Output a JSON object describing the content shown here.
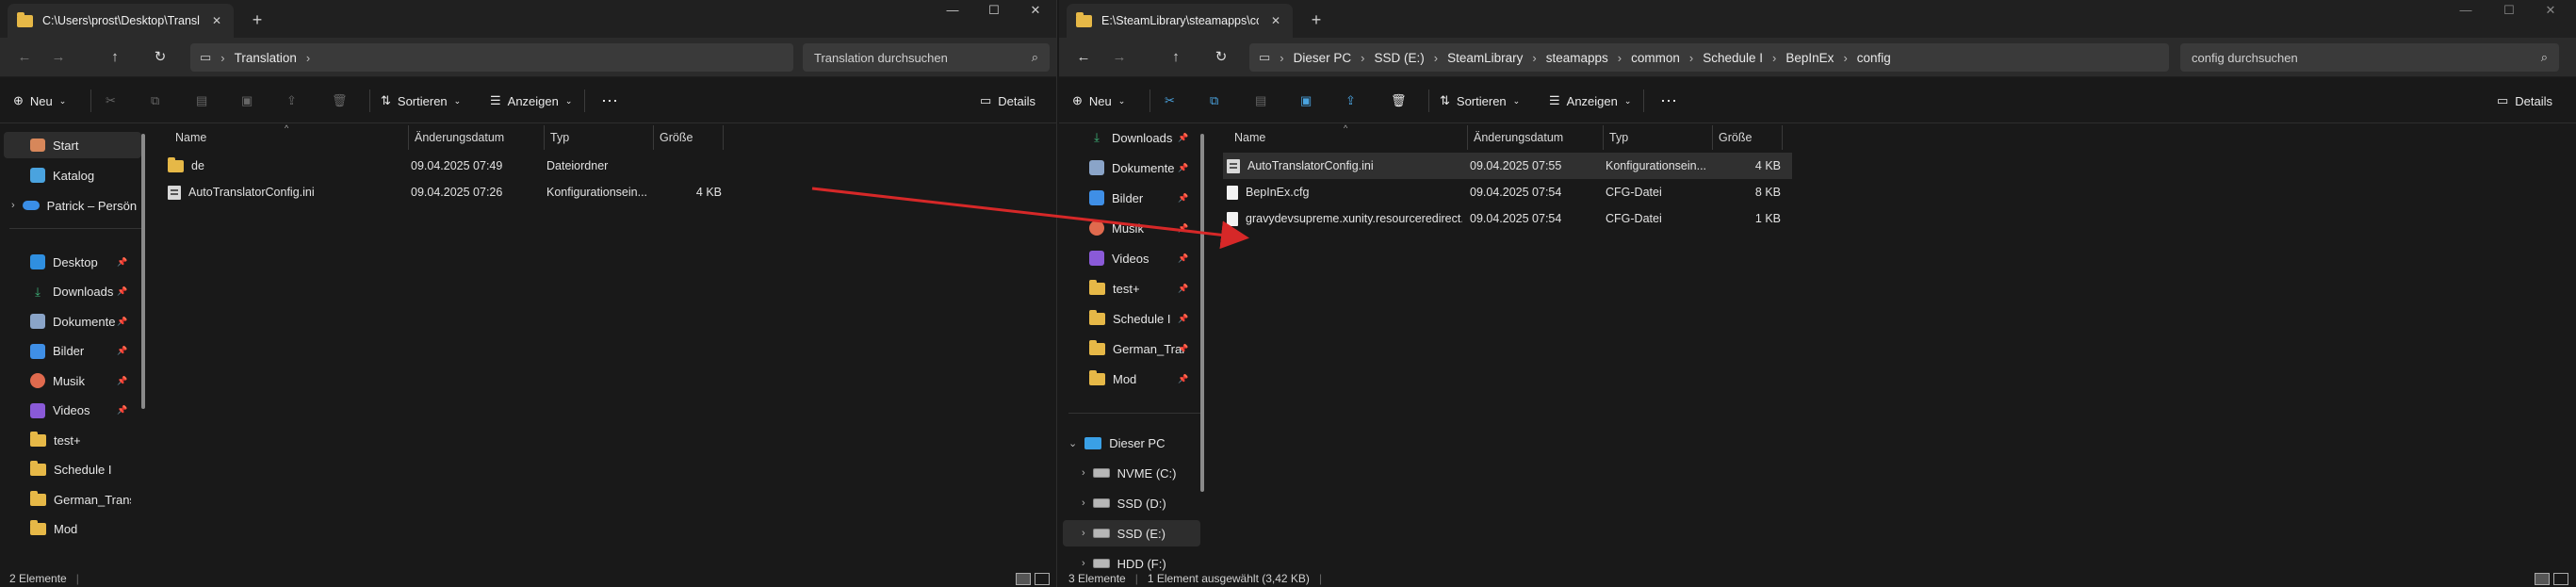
{
  "left": {
    "tab_title": "C:\\Users\\prost\\Desktop\\Transl",
    "address": [
      "Translation"
    ],
    "search_placeholder": "Translation durchsuchen",
    "toolbar": {
      "new": "Neu",
      "sort": "Sortieren",
      "view": "Anzeigen",
      "details": "Details"
    },
    "sidebar": {
      "top": [
        {
          "label": "Start",
          "icon": "home-icon"
        },
        {
          "label": "Katalog",
          "icon": "gallery-icon"
        },
        {
          "label": "Patrick – Persön",
          "icon": "onedrive-icon"
        }
      ],
      "quick": [
        {
          "label": "Desktop",
          "icon": "desktop-icon",
          "pinned": true
        },
        {
          "label": "Downloads",
          "icon": "download-icon",
          "pinned": true
        },
        {
          "label": "Dokumente",
          "icon": "documents-icon",
          "pinned": true
        },
        {
          "label": "Bilder",
          "icon": "pictures-icon",
          "pinned": true
        },
        {
          "label": "Musik",
          "icon": "music-icon",
          "pinned": true
        },
        {
          "label": "Videos",
          "icon": "videos-icon",
          "pinned": true
        },
        {
          "label": "test+",
          "icon": "folder-icon",
          "pinned": false
        },
        {
          "label": "Schedule I",
          "icon": "folder-icon",
          "pinned": false
        },
        {
          "label": "German_Transla",
          "icon": "folder-icon",
          "pinned": false
        },
        {
          "label": "Mod",
          "icon": "folder-icon",
          "pinned": false
        }
      ]
    },
    "columns": {
      "name": "Name",
      "date": "Änderungsdatum",
      "type": "Typ",
      "size": "Größe"
    },
    "files": [
      {
        "name": "de",
        "date": "09.04.2025 07:49",
        "type": "Dateiordner",
        "size": "",
        "icon": "folder-icon"
      },
      {
        "name": "AutoTranslatorConfig.ini",
        "date": "09.04.2025 07:26",
        "type": "Konfigurationsein...",
        "size": "4 KB",
        "icon": "ini-file-icon"
      }
    ],
    "status": "2 Elemente"
  },
  "right": {
    "tab_title": "E:\\SteamLibrary\\steamapps\\cc",
    "address": [
      "Dieser PC",
      "SSD (E:)",
      "SteamLibrary",
      "steamapps",
      "common",
      "Schedule I",
      "BepInEx",
      "config"
    ],
    "search_placeholder": "config durchsuchen",
    "toolbar": {
      "new": "Neu",
      "sort": "Sortieren",
      "view": "Anzeigen",
      "details": "Details"
    },
    "sidebar": {
      "quick": [
        {
          "label": "Downloads",
          "icon": "download-icon",
          "pinned": true
        },
        {
          "label": "Dokumente",
          "icon": "documents-icon",
          "pinned": true
        },
        {
          "label": "Bilder",
          "icon": "pictures-icon",
          "pinned": true
        },
        {
          "label": "Musik",
          "icon": "music-icon",
          "pinned": true
        },
        {
          "label": "Videos",
          "icon": "videos-icon",
          "pinned": true
        },
        {
          "label": "test+",
          "icon": "folder-icon",
          "pinned": true
        },
        {
          "label": "Schedule I",
          "icon": "folder-icon",
          "pinned": true
        },
        {
          "label": "German_Trar",
          "icon": "folder-icon",
          "pinned": true
        },
        {
          "label": "Mod",
          "icon": "folder-icon",
          "pinned": true
        }
      ],
      "pc": {
        "label": "Dieser PC"
      },
      "drives": [
        {
          "label": "NVME (C:)"
        },
        {
          "label": "SSD (D:)"
        },
        {
          "label": "SSD (E:)"
        },
        {
          "label": "HDD (F:)"
        }
      ]
    },
    "columns": {
      "name": "Name",
      "date": "Änderungsdatum",
      "type": "Typ",
      "size": "Größe"
    },
    "files": [
      {
        "name": "AutoTranslatorConfig.ini",
        "date": "09.04.2025 07:55",
        "type": "Konfigurationsein...",
        "size": "4 KB",
        "icon": "ini-file-icon",
        "selected": true
      },
      {
        "name": "BepInEx.cfg",
        "date": "09.04.2025 07:54",
        "type": "CFG-Datei",
        "size": "8 KB",
        "icon": "file-icon"
      },
      {
        "name": "gravydevsupreme.xunity.resourceredirect...",
        "date": "09.04.2025 07:54",
        "type": "CFG-Datei",
        "size": "1 KB",
        "icon": "file-icon"
      }
    ],
    "status": "3 Elemente",
    "status_selected": "1 Element ausgewählt (3,42 KB)"
  },
  "arrow_color": "#d62828"
}
